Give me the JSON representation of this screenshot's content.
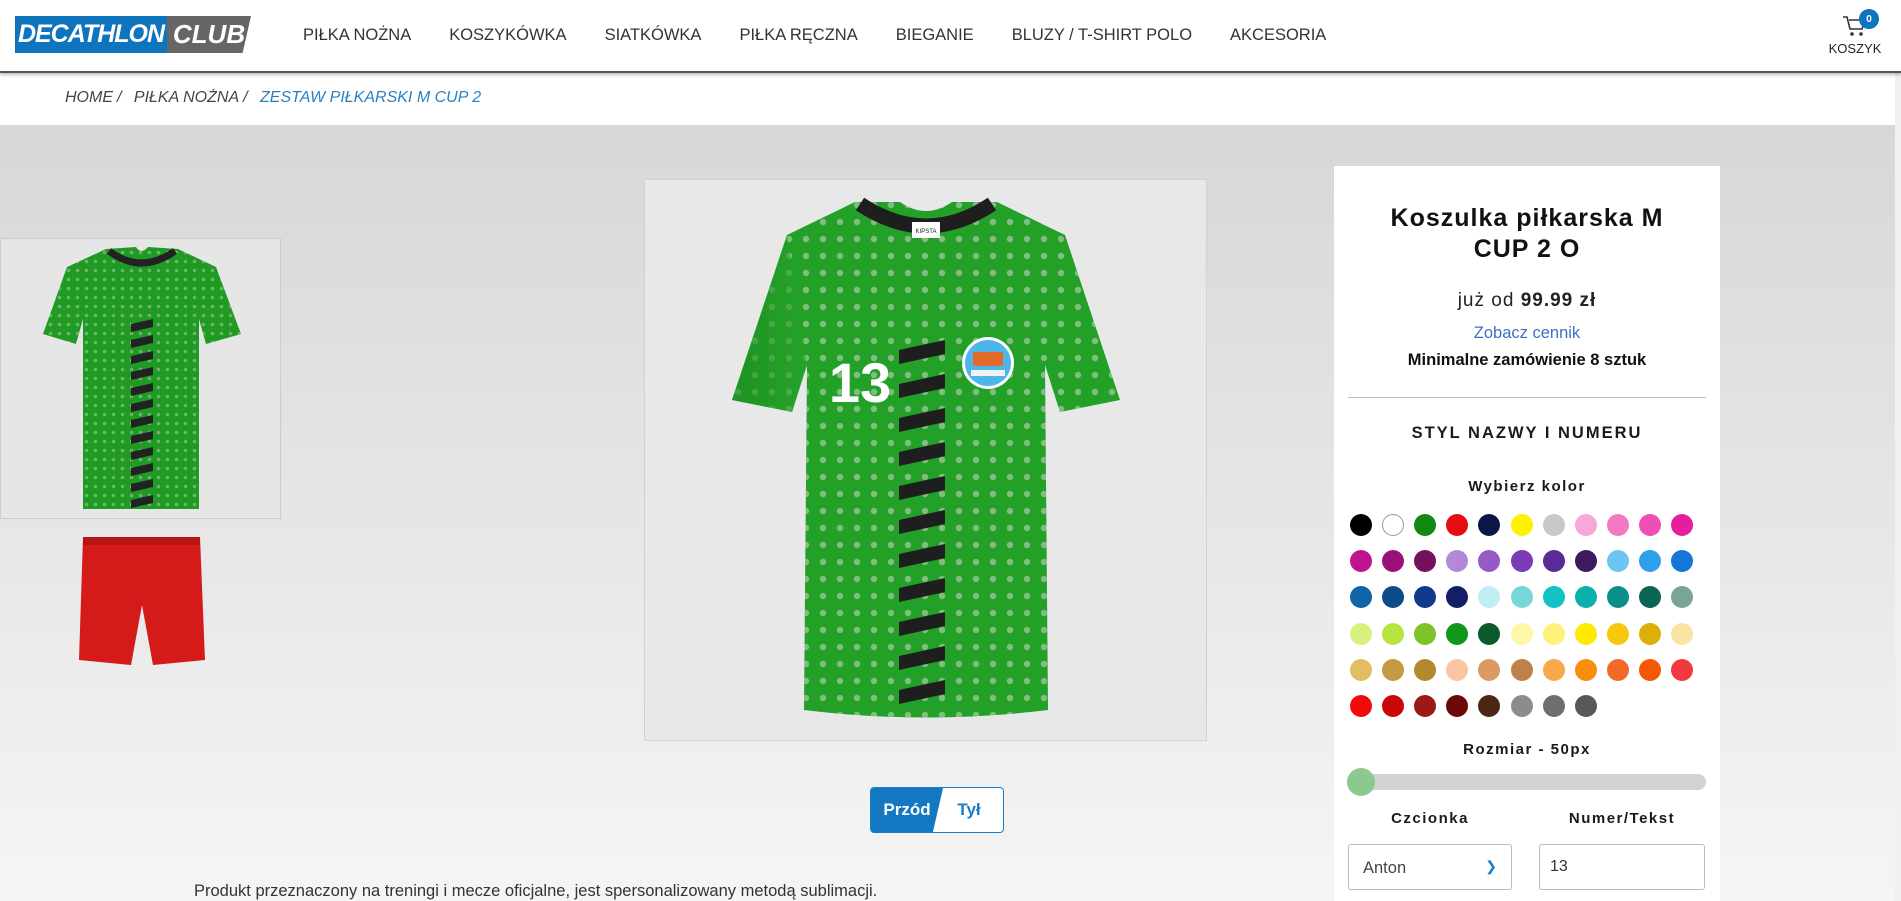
{
  "logo": {
    "left": "DECATHLON",
    "right": "CLUB"
  },
  "nav": [
    "PIŁKA NOŻNA",
    "KOSZYKÓWKA",
    "SIATKÓWKA",
    "PIŁKA RĘCZNA",
    "BIEGANIE",
    "BLUZY / T-SHIRT POLO",
    "AKCESORIA"
  ],
  "cart": {
    "count": "0",
    "label": "KOSZYK"
  },
  "breadcrumb": {
    "home": "HOME",
    "category": "PIŁKA NOŻNA",
    "current": "ZESTAW PIŁKARSKI M CUP 2",
    "sep": "/"
  },
  "preview": {
    "number": "13",
    "brand": "KIPSTA",
    "front_label": "Przód",
    "back_label": "Tył"
  },
  "description": "Produkt przeznaczony na treningi i mecze oficjalne, jest spersonalizowany metodą sublimacji.",
  "panel": {
    "title": "Koszulka piłkarska M CUP 2 O",
    "price_prefix": "już od",
    "price": "99.99 zł",
    "pricelist_link": "Zobacz cennik",
    "min_order": "Minimalne zamówienie 8 sztuk",
    "style_title": "STYL NAZWY I NUMERU",
    "color_title": "Wybierz kolor",
    "size_title": "Rozmiar - 50px",
    "size_value_fraction": 0.0,
    "font_label": "Czcionka",
    "font_value": "Anton",
    "number_label": "Numer/Tekst",
    "number_value": "13"
  },
  "colors": [
    [
      "#000000",
      "#ffffff",
      "#128a12",
      "#e50c13",
      "#0b1747",
      "#fff200",
      "#c8c8c8",
      "#f7a8d8",
      "#f478c4",
      "#ef4fb4",
      "#e41e9c"
    ],
    [
      "#c0148e",
      "#9a1279",
      "#76105d",
      "#b388d8",
      "#9559c8",
      "#7a3bb6",
      "#5a2a96",
      "#3c1a5c",
      "#6cc6f4",
      "#2ea0ea",
      "#1676d6"
    ],
    [
      "#1164a8",
      "#0d4c8a",
      "#11398c",
      "#141e66",
      "#bfeff2",
      "#76d8d6",
      "#14c2c2",
      "#0ab0ac",
      "#0a9088",
      "#0c6456",
      "#78a596"
    ],
    [
      "#d8f07c",
      "#b8e442",
      "#7cc428",
      "#119818",
      "#0c5a2c",
      "#fff6a8",
      "#fff17a",
      "#ffea00",
      "#f6c80c",
      "#dcb008",
      "#fbe3a2"
    ],
    [
      "#e2bd62",
      "#c49a42",
      "#b28a2c",
      "#f9c5a2",
      "#dc9a62",
      "#c0804c",
      "#fba84a",
      "#f98d0c",
      "#f06a28",
      "#f25806",
      "#f03a40"
    ],
    [
      "#f10a0a",
      "#ca0808",
      "#9a1a16",
      "#6c0808",
      "#4c2814",
      "#8c8c8c",
      "#6e6e6e",
      "#585858"
    ]
  ]
}
